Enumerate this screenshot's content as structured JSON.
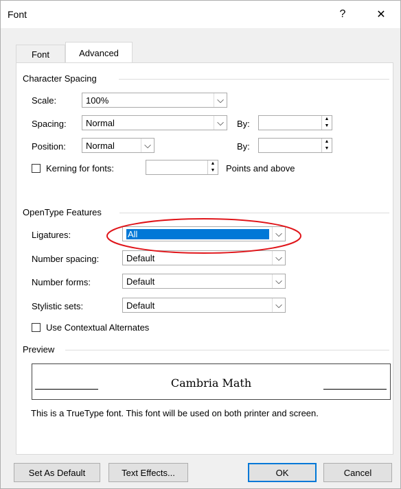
{
  "window": {
    "title": "Font",
    "help_label": "?",
    "close_label": "✕"
  },
  "tabs": [
    {
      "label": "Font"
    },
    {
      "label": "Advanced"
    }
  ],
  "character_spacing": {
    "group_label": "Character Spacing",
    "scale": {
      "label": "Scale:",
      "value": "100%"
    },
    "spacing": {
      "label": "Spacing:",
      "value": "Normal",
      "by_label": "By:",
      "by_value": ""
    },
    "position": {
      "label": "Position:",
      "value": "Normal",
      "by_label": "By:",
      "by_value": ""
    },
    "kerning": {
      "label": "Kerning for fonts:",
      "value": "",
      "suffix": "Points and above",
      "checked": false
    }
  },
  "opentype": {
    "group_label": "OpenType Features",
    "ligatures": {
      "label": "Ligatures:",
      "value": "All"
    },
    "number_spacing": {
      "label": "Number spacing:",
      "value": "Default"
    },
    "number_forms": {
      "label": "Number forms:",
      "value": "Default"
    },
    "stylistic_sets": {
      "label": "Stylistic sets:",
      "value": "Default"
    },
    "contextual": {
      "label": "Use Contextual Alternates",
      "checked": false
    }
  },
  "preview": {
    "group_label": "Preview",
    "sample_text": "Cambria Math",
    "note": "This is a TrueType font. This font will be used on both printer and screen."
  },
  "buttons": {
    "set_default": "Set As Default",
    "text_effects": "Text Effects...",
    "ok": "OK",
    "cancel": "Cancel"
  },
  "annotation": {
    "color": "#e0151a"
  }
}
